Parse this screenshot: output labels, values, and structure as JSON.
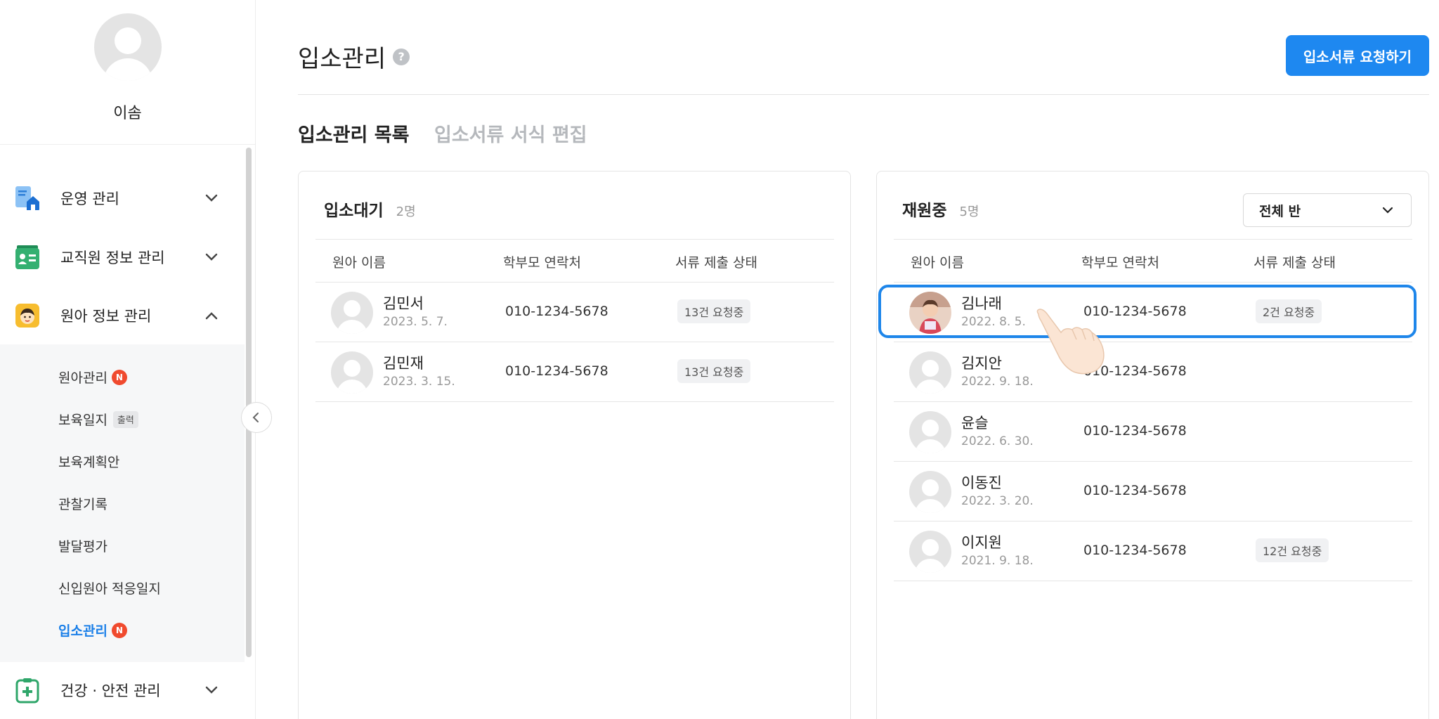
{
  "profile": {
    "name": "이솜"
  },
  "sidebar": {
    "groups": [
      {
        "label": "운영 관리",
        "icon": "document-house-icon",
        "color": "#3a8ee6"
      },
      {
        "label": "교직원 정보 관리",
        "icon": "id-card-icon",
        "color": "#2fa66a"
      },
      {
        "label": "원아 정보 관리",
        "icon": "child-face-icon",
        "color": "#f5b82e"
      },
      {
        "label": "건강 · 안전 관리",
        "icon": "medical-clipboard-icon",
        "color": "#2fa66a"
      }
    ],
    "submenu": [
      {
        "label": "원아관리",
        "badge": "N"
      },
      {
        "label": "보육일지",
        "tag": "출력"
      },
      {
        "label": "보육계획안"
      },
      {
        "label": "관찰기록"
      },
      {
        "label": "발달평가"
      },
      {
        "label": "신입원아 적응일지"
      },
      {
        "label": "입소관리",
        "badge": "N",
        "active": true
      }
    ]
  },
  "header": {
    "title": "입소관리",
    "help": "?",
    "primary_button": "입소서류 요청하기"
  },
  "tabs": [
    {
      "label": "입소관리 목록",
      "active": true
    },
    {
      "label": "입소서류 서식 편집",
      "active": false
    }
  ],
  "columns": {
    "name": "원아 이름",
    "phone": "학부모 연락처",
    "status": "서류 제출 상태"
  },
  "waiting_panel": {
    "title": "입소대기",
    "count": "2명",
    "rows": [
      {
        "name": "김민서",
        "date": "2023. 5. 7.",
        "phone": "010-1234-5678",
        "status": "13건 요청중"
      },
      {
        "name": "김민재",
        "date": "2023. 3. 15.",
        "phone": "010-1234-5678",
        "status": "13건 요청중"
      }
    ]
  },
  "enrolled_panel": {
    "title": "재원중",
    "count": "5명",
    "class_select": "전체 반",
    "rows": [
      {
        "name": "김나래",
        "date": "2022. 8. 5.",
        "phone": "010-1234-5678",
        "status": "2건 요청중",
        "photo": true
      },
      {
        "name": "김지안",
        "date": "2022. 9. 18.",
        "phone": "010-1234-5678",
        "status": ""
      },
      {
        "name": "윤슬",
        "date": "2022. 6. 30.",
        "phone": "010-1234-5678",
        "status": ""
      },
      {
        "name": "이동진",
        "date": "2022. 3. 20.",
        "phone": "010-1234-5678",
        "status": ""
      },
      {
        "name": "이지원",
        "date": "2021. 9. 18.",
        "phone": "010-1234-5678",
        "status": "12건 요청중"
      }
    ]
  },
  "colors": {
    "accent": "#1e88f0",
    "badge": "#f04a2e",
    "highlight": "#1e86ea"
  }
}
